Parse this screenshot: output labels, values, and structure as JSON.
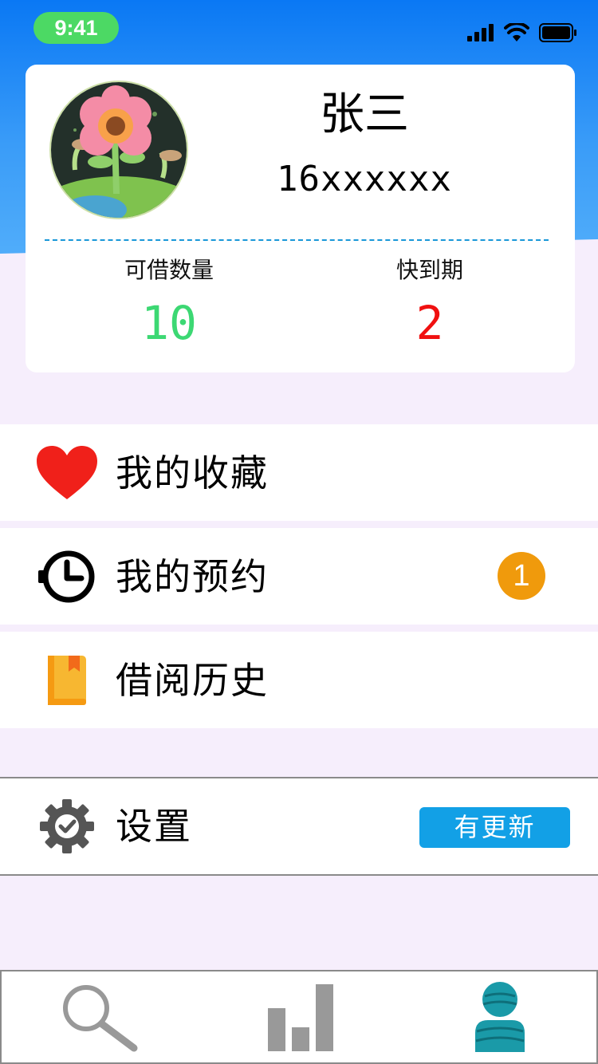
{
  "status_bar": {
    "time": "9:41"
  },
  "profile": {
    "name": "张三",
    "phone": "16xxxxxx",
    "stats": [
      {
        "label": "可借数量",
        "value": "10",
        "color": "#3cd873"
      },
      {
        "label": "快到期",
        "value": "2",
        "color": "#f01010"
      }
    ]
  },
  "menu": {
    "favorites": {
      "label": "我的收藏",
      "icon": "heart-icon"
    },
    "reservations": {
      "label": "我的预约",
      "icon": "clock-icon",
      "badge": "1"
    },
    "history": {
      "label": "借阅历史",
      "icon": "book-icon"
    },
    "settings": {
      "label": "设置",
      "icon": "gear-icon",
      "badge": "有更新"
    }
  },
  "tab_bar": {
    "tabs": [
      {
        "icon": "search-icon",
        "active": false
      },
      {
        "icon": "bar-chart-icon",
        "active": false
      },
      {
        "icon": "person-icon",
        "active": true
      }
    ]
  },
  "colors": {
    "header": "#0a78f4",
    "background": "#f6eefc",
    "badge_orange": "#f09a0c",
    "update_blue": "#12a0e6",
    "heart_red": "#f0201a"
  }
}
